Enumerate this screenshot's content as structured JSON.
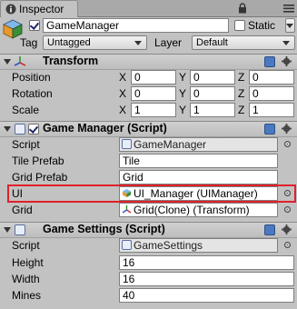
{
  "window": {
    "tab_label": "Inspector"
  },
  "object": {
    "active": true,
    "name": "GameManager",
    "static_label": "Static",
    "static_checked": false,
    "tag_label": "Tag",
    "tag_value": "Untagged",
    "layer_label": "Layer",
    "layer_value": "Default"
  },
  "transform": {
    "title": "Transform",
    "rows": [
      {
        "label": "Position",
        "x": "0",
        "y": "0",
        "z": "0"
      },
      {
        "label": "Rotation",
        "x": "0",
        "y": "0",
        "z": "0"
      },
      {
        "label": "Scale",
        "x": "1",
        "y": "1",
        "z": "1"
      }
    ],
    "axis_x": "X",
    "axis_y": "Y",
    "axis_z": "Z"
  },
  "game_manager": {
    "title": "Game Manager (Script)",
    "enabled": true,
    "fields": [
      {
        "label": "Script",
        "value": "GameManager"
      },
      {
        "label": "Tile Prefab",
        "value": "Tile"
      },
      {
        "label": "Grid Prefab",
        "value": "Grid"
      },
      {
        "label": "UI",
        "value": "UI_Manager (UIManager)"
      },
      {
        "label": "Grid",
        "value": "Grid(Clone) (Transform)"
      }
    ]
  },
  "game_settings": {
    "title": "Game Settings (Script)",
    "fields": [
      {
        "label": "Script",
        "value": "GameSettings"
      },
      {
        "label": "Height",
        "value": "16"
      },
      {
        "label": "Width",
        "value": "16"
      },
      {
        "label": "Mines",
        "value": "40"
      }
    ]
  },
  "colors": {
    "highlight": "#e0202a",
    "background": "#c2c2c2"
  }
}
